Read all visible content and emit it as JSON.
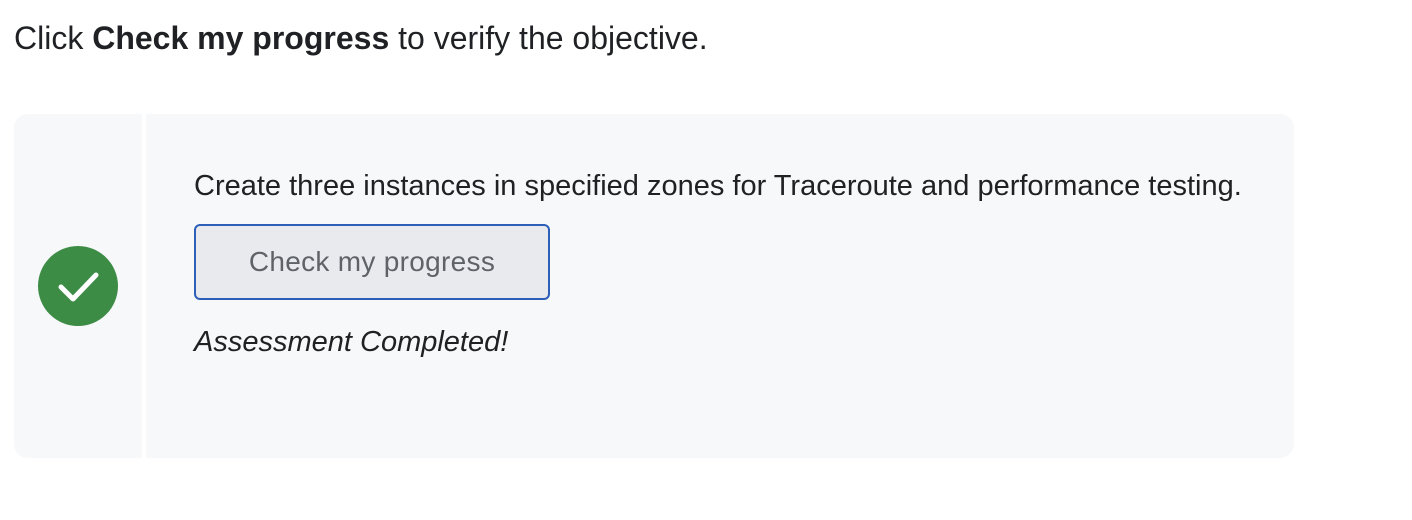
{
  "intro": {
    "prefix": "Click ",
    "bold": "Check my progress",
    "suffix": " to verify the objective."
  },
  "task": {
    "status_icon": "check-circle-icon",
    "status_color": "#3d8c46",
    "objective": "Create three instances in specified zones for Traceroute and performance testing.",
    "button_label": "Check my progress",
    "status_text": "Assessment Completed!"
  }
}
